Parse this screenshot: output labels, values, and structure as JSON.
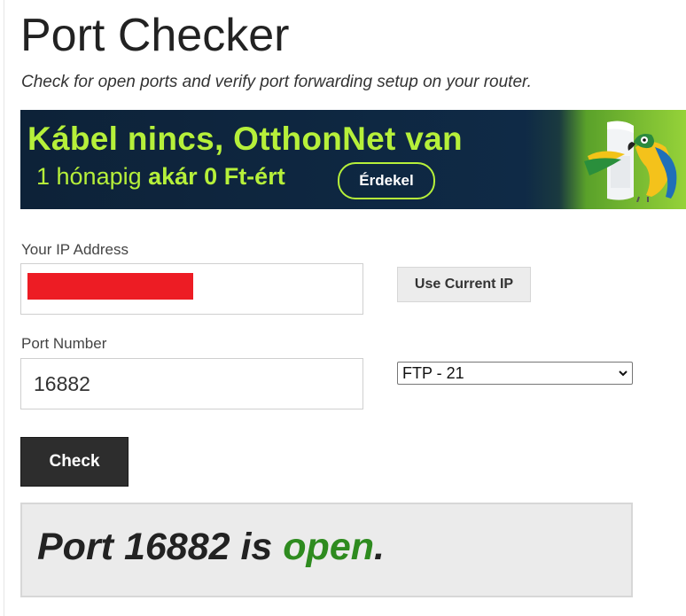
{
  "header": {
    "title": "Port Checker",
    "subtitle": "Check for open ports and verify port forwarding setup on your router."
  },
  "banner": {
    "headline": "Kábel nincs, OtthonNet van",
    "sub_prefix": "1 hónapig ",
    "sub_bold": "akár 0 Ft-ért",
    "cta": "Érdekel",
    "colors": {
      "background": "#0f2a46",
      "accent": "#b6f03a"
    }
  },
  "form": {
    "ip_label": "Your IP Address",
    "ip_value": "",
    "use_current_ip": "Use Current IP",
    "port_label": "Port Number",
    "port_value": "16882",
    "service_selected": "FTP - 21",
    "check_button": "Check"
  },
  "result": {
    "prefix": "Port 16882 is ",
    "status": "open",
    "suffix": ".",
    "status_color": "#2e8b1f"
  }
}
